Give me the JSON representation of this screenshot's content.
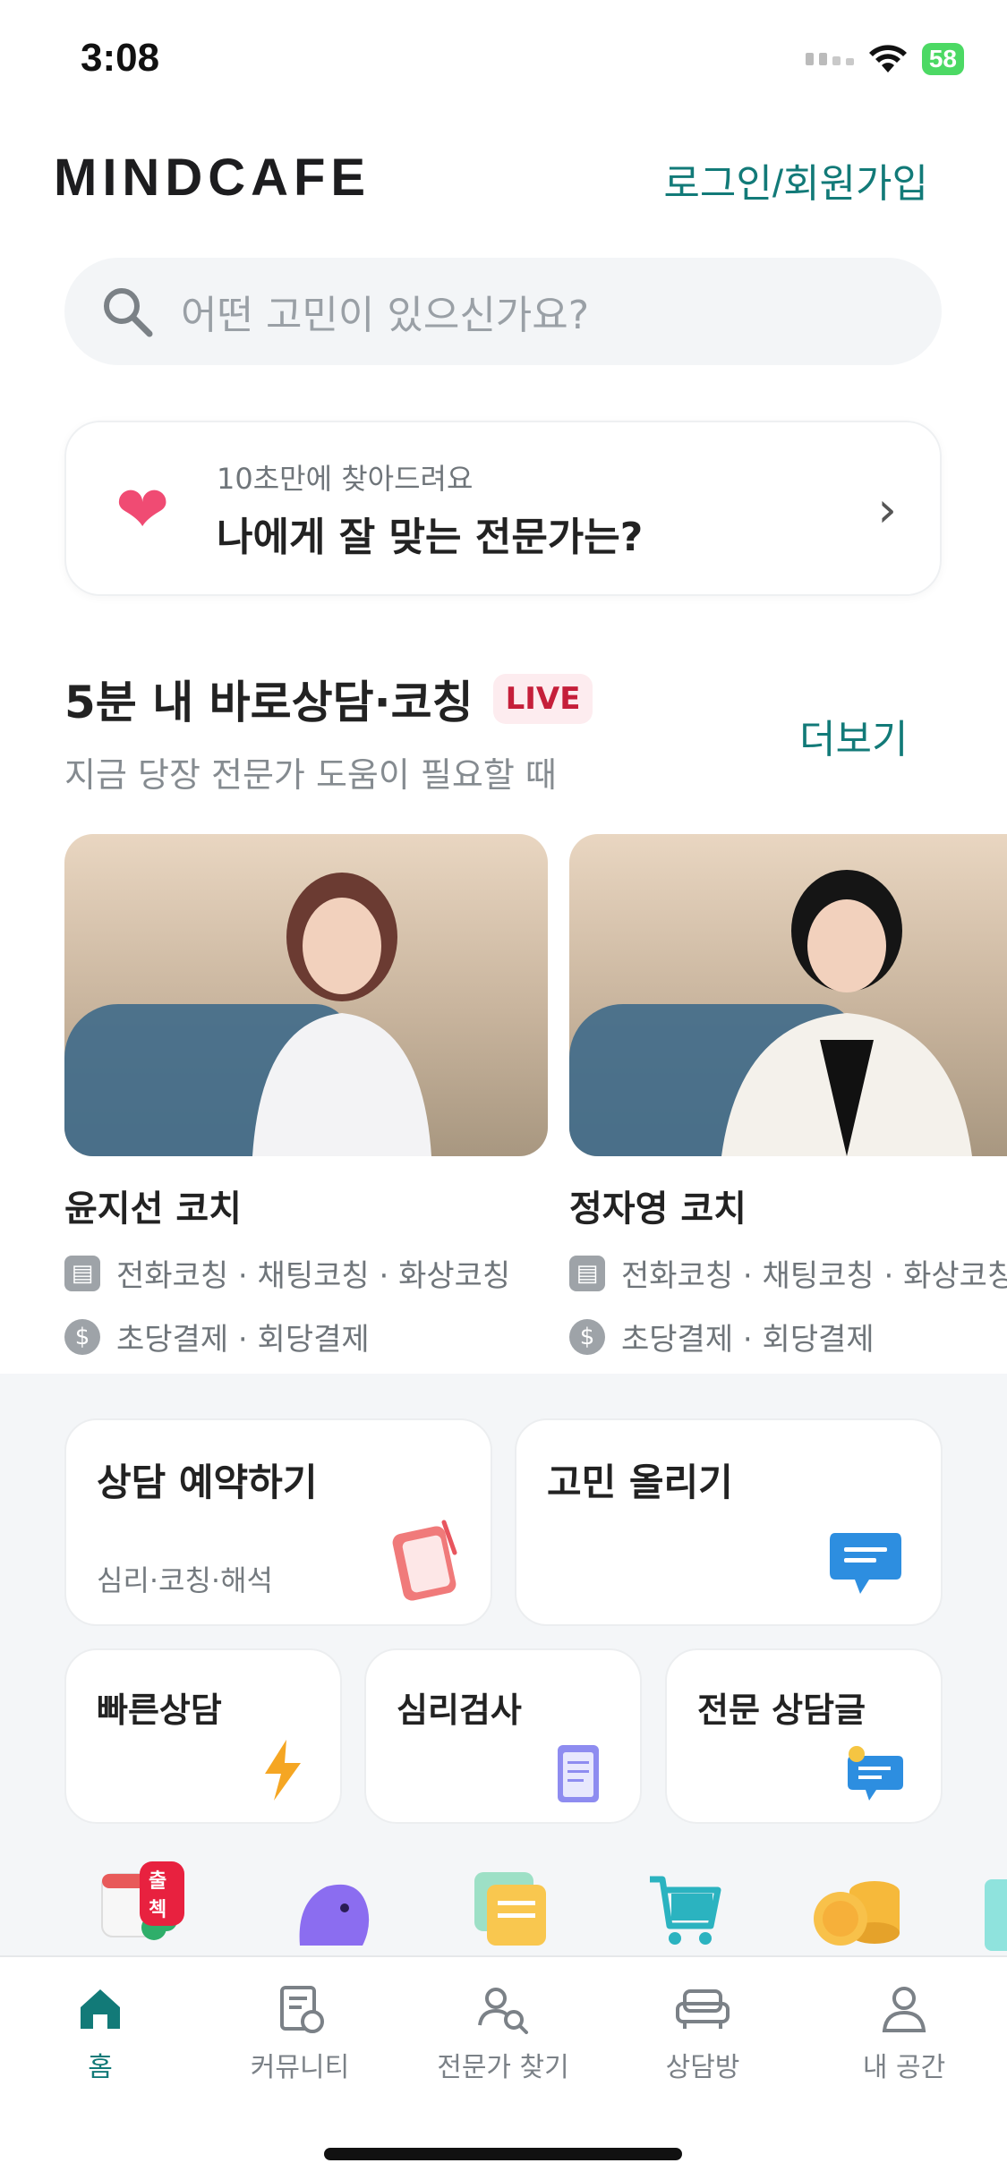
{
  "status": {
    "time": "3:08",
    "battery": "58"
  },
  "header": {
    "logo": "MINDCAFE",
    "login_label": "로그인/회원가입"
  },
  "search": {
    "placeholder": "어떤 고민이 있으신가요?"
  },
  "matching": {
    "subtitle": "10초만에 찾아드려요",
    "title": "나에게 잘 맞는 전문가는?"
  },
  "live_section": {
    "title": "5분 내 바로상담·코칭",
    "badge": "LIVE",
    "subtitle": "지금 당장 전문가 도움이 필요할 때",
    "more_label": "더보기",
    "coaches": [
      {
        "name": "윤지선 코치",
        "services": "전화코칭 · 채팅코칭 · 화상코칭",
        "payment": "초당결제 · 회당결제"
      },
      {
        "name": "정자영 코치",
        "services": "전화코칭 · 채팅코칭 · 화상코칭",
        "payment": "초당결제 · 회당결제"
      }
    ]
  },
  "menu": {
    "booking": {
      "title": "상담 예약하기",
      "subtitle": "심리·코칭·해석"
    },
    "post": {
      "title": "고민 올리기"
    },
    "quick": {
      "title": "빠른상담"
    },
    "test": {
      "title": "심리검사"
    },
    "articles": {
      "title": "전문 상담글"
    }
  },
  "shortcuts": {
    "attendance_badge": "출첵"
  },
  "tabbar": {
    "home": "홈",
    "community": "커뮤니티",
    "find_expert": "전문가 찾기",
    "counsel_room": "상담방",
    "my_space": "내 공간"
  },
  "colors": {
    "accent": "#127a78",
    "live_red": "#c51f3a",
    "background_gray": "#f4f6f8"
  }
}
